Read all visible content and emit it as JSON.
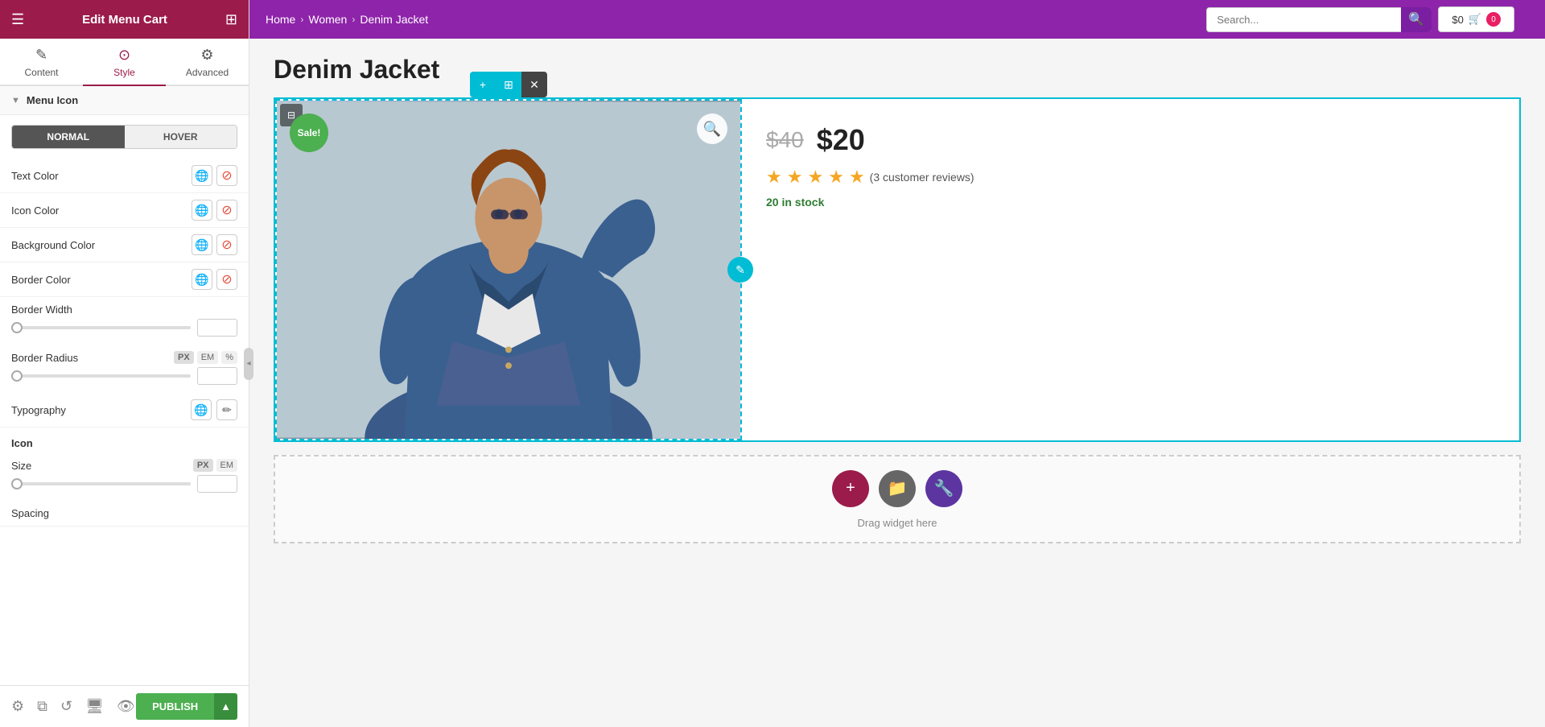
{
  "panel": {
    "title": "Edit Menu Cart",
    "tabs": [
      {
        "label": "Content",
        "icon": "✎"
      },
      {
        "label": "Style",
        "icon": "⊙",
        "active": true
      },
      {
        "label": "Advanced",
        "icon": "⚙"
      }
    ],
    "section": {
      "title": "Menu Icon"
    },
    "toggle": {
      "normal": "NORMAL",
      "hover": "HOVER"
    },
    "properties": [
      {
        "label": "Text Color"
      },
      {
        "label": "Icon Color"
      },
      {
        "label": "Background Color"
      },
      {
        "label": "Border Color"
      }
    ],
    "sliders": [
      {
        "label": "Border Width"
      },
      {
        "label": "Border Radius"
      }
    ],
    "typography": {
      "label": "Typography"
    },
    "icon_section": "Icon",
    "size_label": "Size",
    "spacing_label": "Spacing",
    "units": [
      "PX",
      "EM",
      "%"
    ]
  },
  "bottom_bar": {
    "publish_label": "PUBLISH"
  },
  "nav": {
    "breadcrumb": [
      "Home",
      "Women",
      "Denim Jacket"
    ],
    "search_placeholder": "Search...",
    "cart_price": "$0",
    "cart_count": "0"
  },
  "product": {
    "title": "Denim Jacket",
    "old_price": "$40",
    "new_price": "$20",
    "stars": 5,
    "review_count": "(3 customer reviews)",
    "stock": "20 in stock",
    "sale_badge": "Sale!"
  },
  "drag_area": {
    "text": "Drag widget here"
  }
}
